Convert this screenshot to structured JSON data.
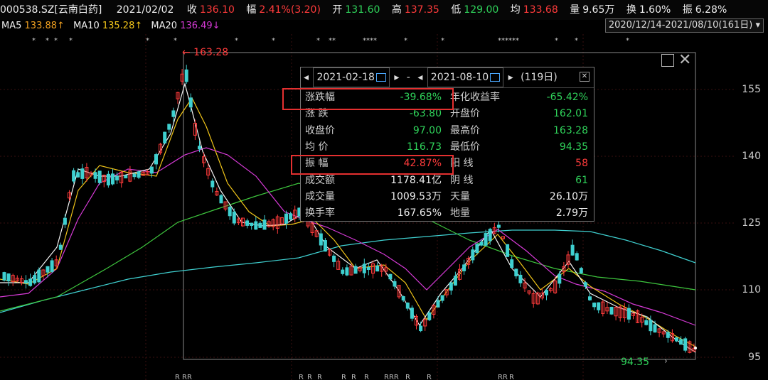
{
  "header": {
    "code_name": "000538.SZ[云南白药]",
    "date": "2021/02/02",
    "close_label": "收",
    "close_value": "136.10",
    "change_label": "幅",
    "change_value": "2.41%(3.20)",
    "open_label": "开",
    "open_value": "131.60",
    "high_label": "高",
    "high_value": "137.35",
    "low_label": "低",
    "low_value": "129.00",
    "avg_label": "均",
    "avg_value": "133.68",
    "vol_label": "量",
    "vol_value": "9.65万",
    "turnover_label": "换",
    "turnover_value": "1.60%",
    "amplitude_label": "振",
    "amplitude_value": "6.28%"
  },
  "ma": {
    "ma5_label": "MA5",
    "ma5_value": "133.88↑",
    "ma10_label": "MA10",
    "ma10_value": "135.28↑",
    "ma20_label": "MA20",
    "ma20_value": "136.49↓",
    "range": "2020/12/14-2021/08/10(161日)",
    "colors": {
      "ma5": "#f5f5f5",
      "ma10": "#f0c419",
      "ma20": "#d63ad6",
      "ma60": "#3ec63e",
      "ma120": "#3fd0d0"
    }
  },
  "chart_labels": {
    "peak": "← 163.28",
    "low": "94.35",
    "y_ticks": [
      "155",
      "140",
      "125",
      "110",
      "95"
    ]
  },
  "popup": {
    "start_date": "2021-02-18",
    "end_date": "2021-08-10",
    "days": "(119日)",
    "sep": "-",
    "rows": [
      {
        "l1": "涨跌幅",
        "v1": "-39.68%",
        "c1": "green",
        "l2": "年化收益率",
        "v2": "-65.42%",
        "c2": "green"
      },
      {
        "l1": "涨  跌",
        "v1": "-63.80",
        "c1": "green",
        "l2": "开盘价",
        "v2": "162.01",
        "c2": "green"
      },
      {
        "l1": "收盘价",
        "v1": "97.00",
        "c1": "green",
        "l2": "最高价",
        "v2": "163.28",
        "c2": "green"
      },
      {
        "l1": "均  价",
        "v1": "116.73",
        "c1": "green",
        "l2": "最低价",
        "v2": "94.35",
        "c2": "green"
      },
      {
        "l1": "振  幅",
        "v1": "42.87%",
        "c1": "red",
        "l2": "阳  线",
        "v2": "58",
        "c2": "red"
      },
      {
        "l1": "成交额",
        "v1": "1178.41亿",
        "c1": "white",
        "l2": "阴  线",
        "v2": "61",
        "c2": "green"
      },
      {
        "l1": "成交量",
        "v1": "1009.53万",
        "c1": "white",
        "l2": "天量",
        "v2": "26.10万",
        "c2": "white"
      },
      {
        "l1": "换手率",
        "v1": "167.65%",
        "c1": "white",
        "l2": "地量",
        "v2": "2.79万",
        "c2": "white"
      }
    ]
  }
}
